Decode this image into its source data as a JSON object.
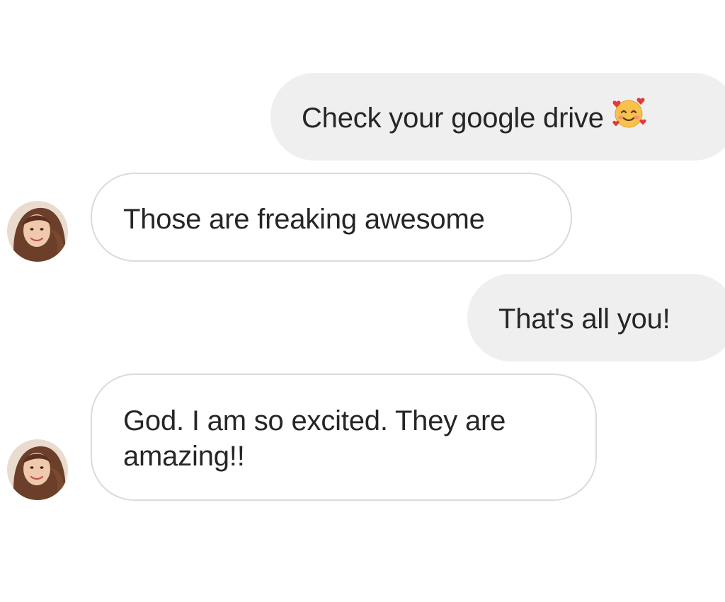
{
  "conversation": {
    "messages": [
      {
        "sender": "me",
        "text": "Check your google drive",
        "emoji": "smiling-face-with-hearts"
      },
      {
        "sender": "contact",
        "text": "Those are freaking awesome"
      },
      {
        "sender": "me",
        "text": "That's all you!"
      },
      {
        "sender": "contact",
        "text": "God. I am so excited. They are amazing!!"
      }
    ]
  },
  "colors": {
    "sent_bubble": "#efefef",
    "received_border": "#dbdbdb",
    "text": "#262626"
  }
}
